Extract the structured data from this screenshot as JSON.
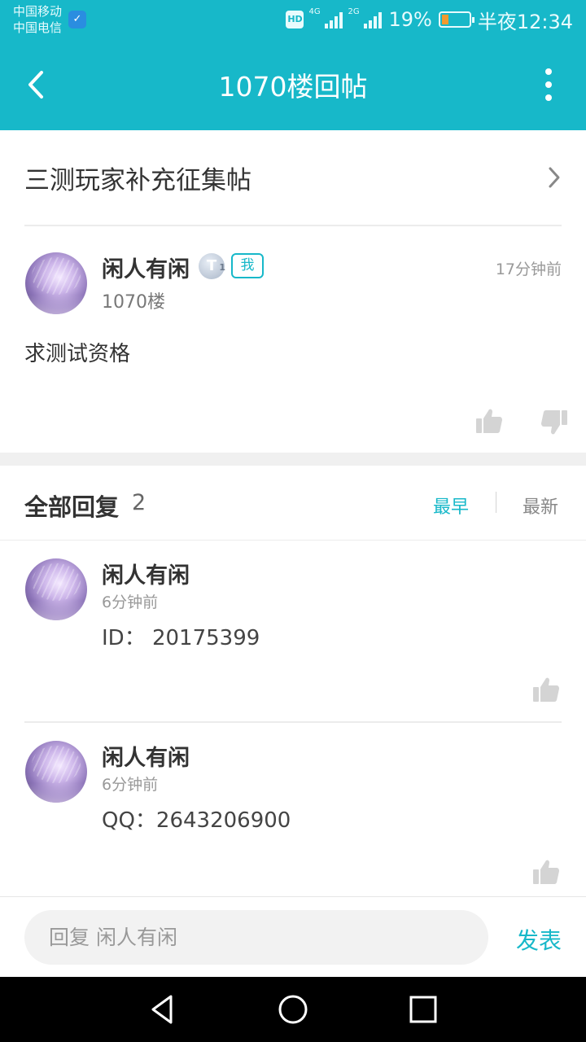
{
  "status_bar": {
    "carrier_1": "中国移动",
    "carrier_2": "中国电信",
    "network_1": "4G",
    "network_2": "2G",
    "battery": "19%",
    "time": "半夜12:34",
    "icons": [
      "shield-icon",
      "hd-icon",
      "signal-icon",
      "battery-icon"
    ]
  },
  "app_bar": {
    "title": "1070楼回帖",
    "back_icon": "chevron-left-icon",
    "menu_icon": "more-vertical-icon"
  },
  "thread": {
    "title": "三测玩家补充征集帖",
    "chevron_icon": "chevron-right-icon"
  },
  "floor_post": {
    "author": "闲人有闲",
    "level_badge": "T",
    "level_sub": "1",
    "me_label": "我",
    "time": "17分钟前",
    "floor": "1070楼",
    "content": "求测试资格"
  },
  "replies": {
    "label": "全部回复",
    "count": "2",
    "sort_earliest": "最早",
    "sort_newest": "最新",
    "items": [
      {
        "author": "闲人有闲",
        "time": "6分钟前",
        "content": "ID： 20175399"
      },
      {
        "author": "闲人有闲",
        "time": "6分钟前",
        "content": "QQ：2643206900"
      }
    ]
  },
  "reply_box": {
    "placeholder": "回复 闲人有闲",
    "send_label": "发表"
  },
  "colors": {
    "accent": "#17b8c9",
    "battery_low": "#f29a2e"
  }
}
